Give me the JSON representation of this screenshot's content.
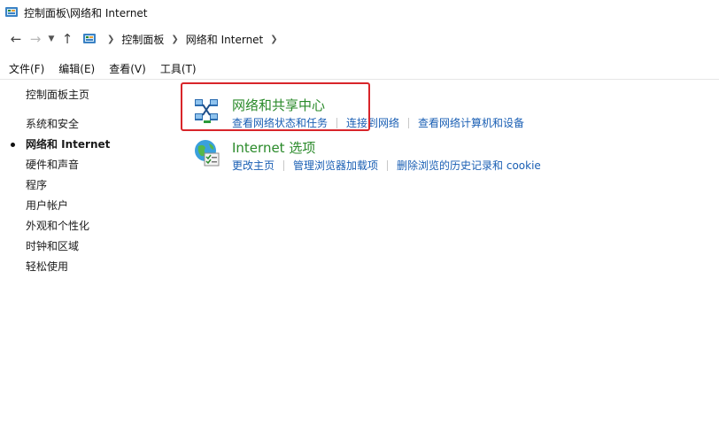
{
  "window": {
    "title": "控制面板\\网络和 Internet"
  },
  "address": {
    "crumbs": [
      "控制面板",
      "网络和 Internet"
    ]
  },
  "menu": [
    "文件(F)",
    "编辑(E)",
    "查看(V)",
    "工具(T)"
  ],
  "sidebar": {
    "home": "控制面板主页",
    "items": [
      {
        "label": "系统和安全",
        "active": false
      },
      {
        "label": "网络和 Internet",
        "active": true
      },
      {
        "label": "硬件和声音",
        "active": false
      },
      {
        "label": "程序",
        "active": false
      },
      {
        "label": "用户帐户",
        "active": false
      },
      {
        "label": "外观和个性化",
        "active": false
      },
      {
        "label": "时钟和区域",
        "active": false
      },
      {
        "label": "轻松使用",
        "active": false
      }
    ]
  },
  "sections": [
    {
      "title": "网络和共享中心",
      "icon": "network-icon",
      "links": [
        "查看网络状态和任务",
        "连接到网络",
        "查看网络计算机和设备"
      ]
    },
    {
      "title": "Internet 选项",
      "icon": "internet-options-icon",
      "links": [
        "更改主页",
        "管理浏览器加载项",
        "删除浏览的历史记录和 cookie"
      ]
    }
  ],
  "colors": {
    "link": "#1a5fb4",
    "section_title": "#2a8a2a",
    "highlight": "#d8252a"
  }
}
